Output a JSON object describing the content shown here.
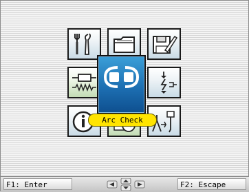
{
  "menu": {
    "selected_label": "Arc Check",
    "items": [
      {
        "icon": "tools-icon"
      },
      {
        "icon": "folder-icon"
      },
      {
        "icon": "floppy-save-icon"
      },
      {
        "icon": "resistor-coil-icon"
      },
      {
        "icon": "arc-check-icon"
      },
      {
        "icon": "lightning-ground-icon"
      },
      {
        "icon": "info-icon"
      },
      {
        "icon": "schedule-clock-icon"
      },
      {
        "icon": "torch-pin-icon"
      }
    ]
  },
  "footer": {
    "f1_label": "F1: Enter",
    "f2_label": "F2: Escape",
    "nav_icon": "arrow-keys-icon"
  },
  "colors": {
    "highlight": "#ffe400",
    "selected_tile": "#1d6fb2",
    "blue_tile_tint": "#c9dbe6",
    "green_tile_tint": "#c3dcb5"
  }
}
